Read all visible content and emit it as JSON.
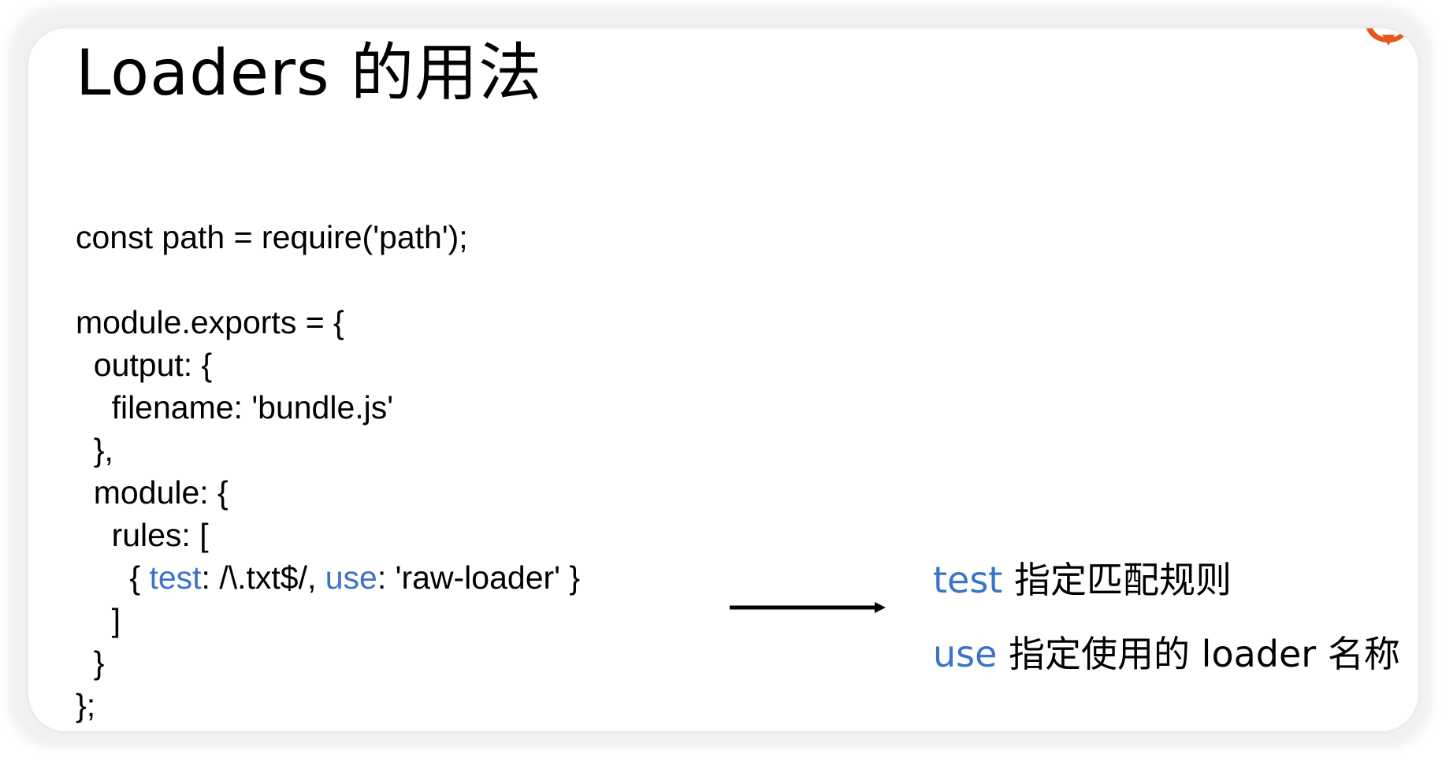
{
  "slide": {
    "title": "Loaders 的用法",
    "code_lines": [
      [
        {
          "t": "const path = require('path');"
        }
      ],
      [
        {
          "t": ""
        }
      ],
      [
        {
          "t": "module.exports = {"
        }
      ],
      [
        {
          "t": "  output: {"
        }
      ],
      [
        {
          "t": "    filename: 'bundle.js'"
        }
      ],
      [
        {
          "t": "  },"
        }
      ],
      [
        {
          "t": "  module: {"
        }
      ],
      [
        {
          "t": "    rules: ["
        }
      ],
      [
        {
          "t": "      { "
        },
        {
          "t": "test",
          "kw": true
        },
        {
          "t": ": /\\.txt$/, "
        },
        {
          "t": "use",
          "kw": true
        },
        {
          "t": ": 'raw-loader' }"
        }
      ],
      [
        {
          "t": "    ]"
        }
      ],
      [
        {
          "t": "  }"
        }
      ],
      [
        {
          "t": "};"
        }
      ]
    ],
    "notes": [
      {
        "keyword": "test",
        "text": " 指定匹配规则"
      },
      {
        "keyword": "use",
        "text": " 指定使用的 loader 名称"
      }
    ],
    "arrow_icon": "right-arrow-icon",
    "logo_icon": "brand-logo-icon",
    "colors": {
      "keyword": "#3b73c8",
      "text": "#000000",
      "logo": "#e8561e"
    }
  }
}
